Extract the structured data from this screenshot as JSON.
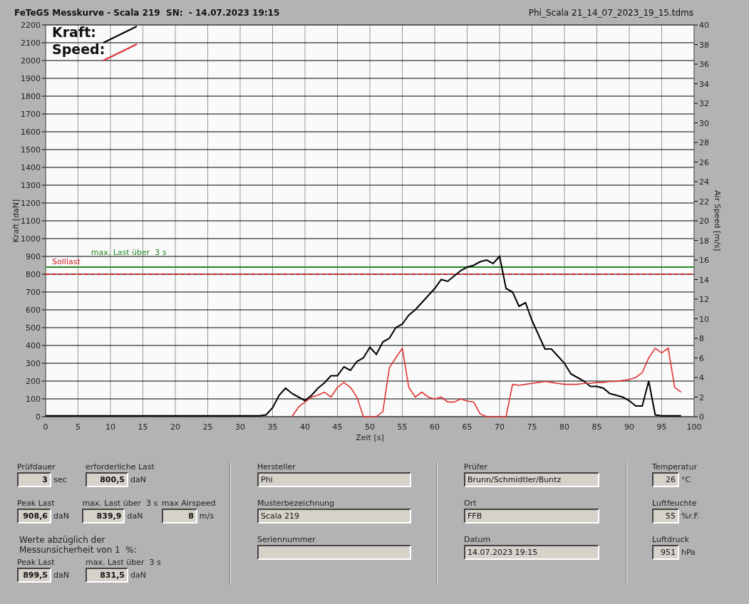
{
  "header": {
    "title": "FeTeGS Messkurve - Scala 219  SN:  - 14.07.2023 19:15",
    "file": "Phi_Scala 21_14_07_2023_19_15.tdms"
  },
  "chart": {
    "chart_data": {
      "type": "line",
      "xlabel": "Zeit [s]",
      "ylabel": "Kraft [daN]",
      "x": [
        0,
        5,
        10,
        15,
        20,
        25,
        30,
        33,
        34,
        35,
        36,
        37,
        38,
        39,
        40,
        41,
        42,
        43,
        44,
        45,
        46,
        47,
        48,
        49,
        50,
        51,
        52,
        53,
        54,
        55,
        56,
        57,
        58,
        59,
        60,
        61,
        62,
        63,
        64,
        65,
        66,
        67,
        68,
        69,
        70,
        71,
        72,
        73,
        74,
        75,
        76,
        77,
        78,
        79,
        80,
        81,
        82,
        83,
        84,
        85,
        86,
        87,
        88,
        89,
        90,
        91,
        92,
        93,
        94,
        95,
        96,
        97,
        98
      ],
      "series": [
        {
          "name": "Kraft:",
          "color": "#000000",
          "values": [
            5,
            5,
            5,
            5,
            5,
            5,
            5,
            5,
            10,
            50,
            120,
            160,
            130,
            110,
            90,
            120,
            160,
            190,
            230,
            230,
            280,
            260,
            310,
            330,
            390,
            350,
            420,
            440,
            500,
            520,
            570,
            600,
            640,
            680,
            720,
            770,
            760,
            790,
            820,
            840,
            850,
            870,
            880,
            860,
            900,
            720,
            700,
            620,
            640,
            540,
            460,
            380,
            380,
            340,
            300,
            240,
            220,
            200,
            170,
            170,
            160,
            130,
            120,
            110,
            90,
            60,
            60,
            200,
            10,
            5,
            5,
            5,
            5
          ]
        },
        {
          "name": "Speed:",
          "color": "#dd3333",
          "axis": "y2",
          "values": [
            null,
            null,
            null,
            null,
            null,
            null,
            null,
            null,
            null,
            null,
            null,
            null,
            0,
            1,
            1.5,
            2,
            2.2,
            2.5,
            2,
            3,
            3.5,
            3,
            2,
            0,
            0,
            0,
            0.5,
            5,
            6,
            7,
            3,
            2,
            2.5,
            2,
            1.8,
            2,
            1.5,
            1.5,
            1.8,
            1.6,
            1.5,
            0.3,
            0,
            0,
            0,
            0,
            3.3,
            3.2,
            3.3,
            3.4,
            3.5,
            3.6,
            3.5,
            3.4,
            3.3,
            3.3,
            3.3,
            3.4,
            3.4,
            3.5,
            3.5,
            3.6,
            3.6,
            3.7,
            3.8,
            4,
            4.5,
            6,
            7,
            6.5,
            7,
            3,
            2.5
          ]
        }
      ],
      "xlim": [
        0,
        100
      ],
      "ylim": [
        0,
        2200
      ],
      "xticks": [
        0,
        5,
        10,
        15,
        20,
        25,
        30,
        35,
        40,
        45,
        50,
        55,
        60,
        65,
        70,
        75,
        80,
        85,
        90,
        95,
        100
      ],
      "yticks": [
        0,
        100,
        200,
        300,
        400,
        500,
        600,
        700,
        800,
        900,
        1000,
        1100,
        1200,
        1300,
        1400,
        1500,
        1600,
        1700,
        1800,
        1900,
        2000,
        2100,
        2200
      ],
      "y2label": "Air Speed [m/s]",
      "y2lim": [
        0,
        40
      ],
      "y2ticks": [
        0,
        2,
        4,
        6,
        8,
        10,
        12,
        14,
        16,
        18,
        20,
        22,
        24,
        26,
        28,
        30,
        32,
        34,
        36,
        38,
        40
      ],
      "grid": true,
      "legend": "upper left",
      "ref_lines": [
        {
          "axis": "y",
          "value": 800,
          "label": "Solllast",
          "color": "#cc2222"
        },
        {
          "axis": "y",
          "value": 840,
          "label": "max. Last über  3 s",
          "color": "#228822"
        }
      ]
    }
  },
  "results": {
    "rows": [
      [
        {
          "label": "Prüfdauer",
          "value": "3",
          "unit": "sec"
        },
        {
          "label": "erforderliche Last",
          "value": "800,5",
          "unit": "daN"
        }
      ],
      [
        {
          "label": "Peak Last",
          "value": "908,6",
          "unit": "daN"
        },
        {
          "label": "max. Last über  3 s",
          "value": "839,9",
          "unit": "daN"
        },
        {
          "label": "max Airspeed",
          "value": "8",
          "unit": "m/s"
        }
      ]
    ],
    "note": "Werte abzüglich der Messunsicherheit von 1  %:",
    "corrected": [
      {
        "label": "Peak Last",
        "value": "899,5",
        "unit": "daN"
      },
      {
        "label": "max. Last über  3 s",
        "value": "831,5",
        "unit": "daN"
      }
    ]
  },
  "sample": [
    {
      "label": "Hersteller",
      "value": "Phi"
    },
    {
      "label": "Musterbezeichnung",
      "value": "Scala 219"
    },
    {
      "label": "Seriennummer"
    }
  ],
  "test": [
    {
      "label": "Prüfer",
      "value": "Brunn/Schmidtler/Buntz"
    },
    {
      "label": "Ort",
      "value": "FFB"
    },
    {
      "label": "Datum",
      "value": "14.07.2023 19:15"
    }
  ],
  "environment": [
    {
      "label": "Temperatur",
      "value": "26",
      "unit": "°C"
    },
    {
      "label": "Luftfeuchte",
      "value": "55",
      "unit": "%r.F."
    },
    {
      "label": "Luftdruck",
      "value": "951",
      "unit": "hPa"
    }
  ]
}
